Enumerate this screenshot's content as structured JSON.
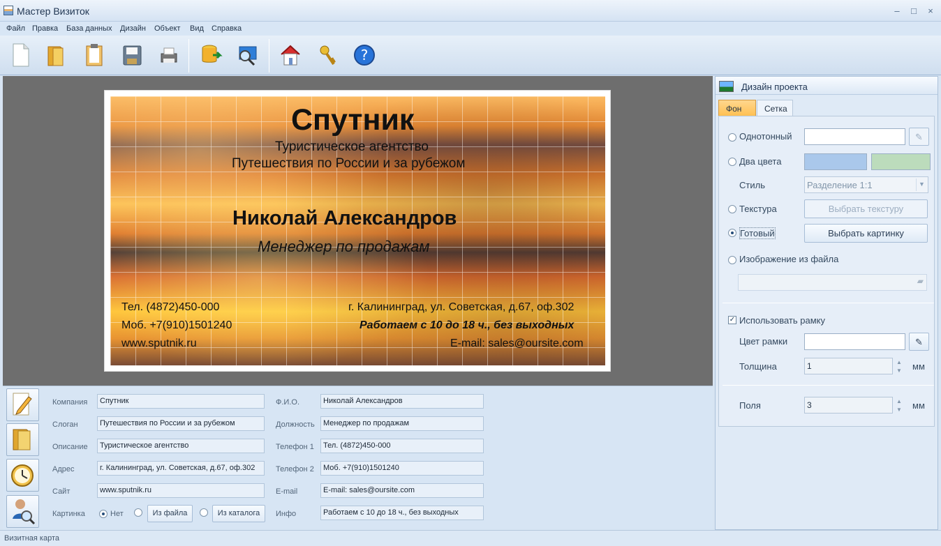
{
  "window": {
    "title": "Мастер Визиток",
    "min": "‒",
    "max": "□",
    "close": "×"
  },
  "menu": [
    "Файл",
    "Правка",
    "База данных",
    "Дизайн",
    "Объект",
    "Вид",
    "Справка"
  ],
  "toolbar": [
    "new-document",
    "open-folder",
    "clipboard",
    "save",
    "print",
    "database-export",
    "search-preview",
    "home",
    "keys",
    "help"
  ],
  "card": {
    "company": "Спутник",
    "description": "Туристическое агентство",
    "slogan": "Путешествия по России и за рубежом",
    "name": "Николай Александров",
    "position": "Менеджер по продажам",
    "phone1": "Тел. (4872)450-000",
    "phone2": "Моб. +7(910)1501240",
    "site": "www.sputnik.ru",
    "address": "г. Калининград, ул. Советская, д.67, оф.302",
    "info": "Работаем с 10 до 18 ч., без выходных",
    "email": "E-mail: sales@oursite.com"
  },
  "design": {
    "title": "Дизайн проекта",
    "tabs": [
      "Фон",
      "Сетка"
    ],
    "solid": "Однотонный",
    "two_colors": "Два цвета",
    "style": "Стиль",
    "style_value": "Разделение 1:1",
    "texture": "Текстура",
    "choose_texture": "Выбрать текстуру",
    "ready": "Готовый",
    "choose_picture": "Выбрать картинку",
    "image_file": "Изображение из файла",
    "use_frame": "Использовать рамку",
    "frame_color": "Цвет рамки",
    "thickness": "Толщина",
    "thickness_value": "1",
    "unit": "мм",
    "fields": "Поля",
    "fields_value": "3",
    "color1": "#aac8eb",
    "color2": "#bcdcbc"
  },
  "form": {
    "labels_left": [
      "Компания",
      "Слоган",
      "Описание",
      "Адрес",
      "Сайт",
      "Картинка"
    ],
    "values_left": [
      "Спутник",
      "Путешествия по России и за рубежом",
      "Туристическое агентство",
      "г. Калининград, ул. Советская, д.67, оф.302",
      "www.sputnik.ru"
    ],
    "labels_right": [
      "Ф.И.О.",
      "Должность",
      "Телефон 1",
      "Телефон 2",
      "E-mail",
      "Инфо"
    ],
    "values_right": [
      "Николай Александров",
      "Менеджер по продажам",
      "Тел. (4872)450-000",
      "Моб. +7(910)1501240",
      "E-mail: sales@oursite.com",
      "Работаем с 10 до 18 ч., без выходных"
    ],
    "picture_none": "Нет",
    "from_file": "Из файла",
    "from_catalog": "Из каталога"
  },
  "status": "Визитная карта"
}
